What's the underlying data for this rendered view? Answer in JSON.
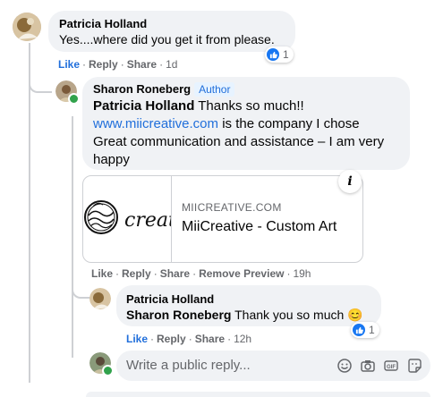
{
  "comments": [
    {
      "author": "Patricia Holland",
      "text": "Yes....where did you get it from please.",
      "actions": {
        "like": "Like",
        "reply": "Reply",
        "share": "Share",
        "time": "1d"
      },
      "reaction_count": "1"
    },
    {
      "author": "Sharon Roneberg",
      "badge": "Author",
      "mention": "Patricia Holland",
      "line1_rest": " Thanks so much!!",
      "link": "www.miicreative.com",
      "line2_rest": " is the company I chose",
      "line3": "Great communication and assistance – I am very",
      "line4": "happy",
      "actions": {
        "like": "Like",
        "reply": "Reply",
        "share": "Share",
        "remove_preview": "Remove Preview",
        "time": "19h"
      }
    },
    {
      "author": "Patricia Holland",
      "mention": "Sharon Roneberg",
      "text_rest": " Thank you so much ",
      "emoji": "😊",
      "actions": {
        "like": "Like",
        "reply": "Reply",
        "share": "Share",
        "time": "12h"
      },
      "reaction_count": "1"
    }
  ],
  "link_preview": {
    "domain": "MIICREATIVE.COM",
    "title": "MiiCreative - Custom Art",
    "logo_script": "creat",
    "info_glyph": "i"
  },
  "reply_box": {
    "placeholder": "Write a public reply...",
    "icons": [
      "emoji-icon",
      "camera-icon",
      "gif-icon",
      "sticker-icon"
    ]
  },
  "colors": {
    "link": "#216fdb",
    "bubble": "#f0f2f5",
    "online": "#31a24c",
    "like": "#1877f2"
  }
}
